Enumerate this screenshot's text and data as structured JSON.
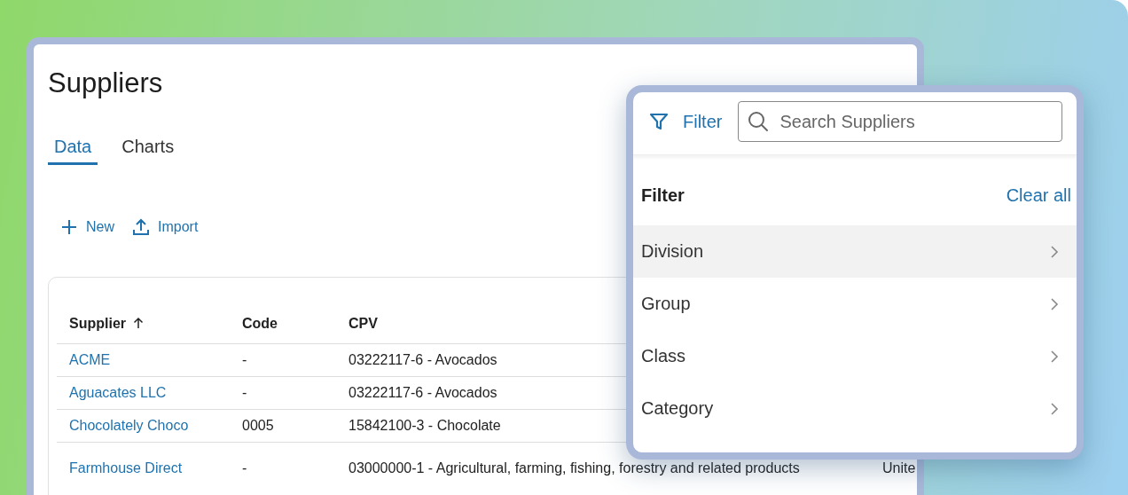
{
  "page": {
    "title": "Suppliers"
  },
  "tabs": [
    {
      "label": "Data",
      "selected": true
    },
    {
      "label": "Charts",
      "selected": false
    }
  ],
  "actions": [
    {
      "label": "New"
    },
    {
      "label": "Import"
    }
  ],
  "table": {
    "columns": [
      {
        "label": "Supplier",
        "sorted": true
      },
      {
        "label": "Code",
        "sorted": false
      },
      {
        "label": "CPV",
        "sorted": false
      }
    ],
    "rows": [
      {
        "cells": [
          "ACME",
          "-",
          "03222117-6 - Avocados"
        ]
      },
      {
        "cells": [
          "Aguacates LLC",
          "-",
          "03222117-6 - Avocados"
        ]
      },
      {
        "cells": [
          "Chocolately Choco",
          "0005",
          "15842100-3 - Chocolate"
        ]
      },
      {
        "cells": [
          "Farmhouse Direct",
          "-",
          "03000000-1 - Agricultural, farming, fishing, forestry and related products",
          "Unite"
        ]
      }
    ]
  },
  "filter_panel": {
    "button": "Filter",
    "search": {
      "placeholder": "Search Suppliers"
    },
    "heading": "Filter",
    "clear": "Clear all",
    "items": [
      {
        "label": "Division",
        "selected": true
      },
      {
        "label": "Group",
        "selected": false
      },
      {
        "label": "Class",
        "selected": false
      },
      {
        "label": "Category",
        "selected": false
      }
    ]
  }
}
